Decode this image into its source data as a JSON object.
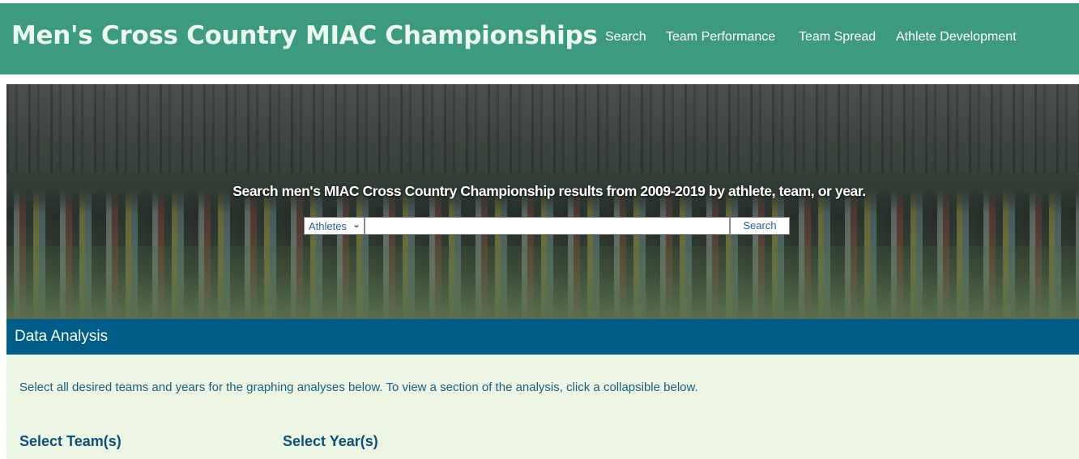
{
  "header": {
    "title": "Men's Cross Country MIAC Championships",
    "nav": [
      "Search",
      "Team Performance",
      "Team Spread",
      "Athlete Development"
    ],
    "bg_color": "#3d9a80"
  },
  "hero": {
    "tagline": "Search men's MIAC Cross Country Championship results from 2009-2019 by athlete, team, or year.",
    "search": {
      "category_selected": "Athletes",
      "input_value": "",
      "button_label": "Search"
    }
  },
  "data_analysis": {
    "title": "Data Analysis",
    "instructions": "Select all desired teams and years for the graphing analyses below. To view a section of the analysis, click a collapsible below.",
    "select_teams_label": "Select Team(s)",
    "select_years_label": "Select Year(s)",
    "bar_color": "#005d87",
    "content_bg": "#ecf5e3"
  }
}
